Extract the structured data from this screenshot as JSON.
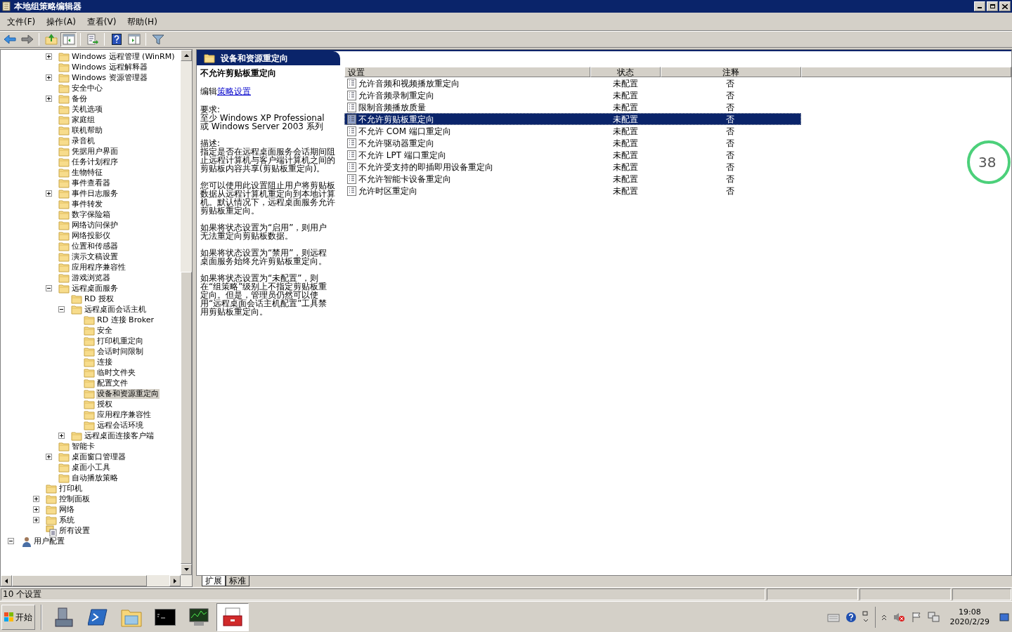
{
  "window": {
    "title": "本地组策略编辑器"
  },
  "menu": [
    "文件(F)",
    "操作(A)",
    "查看(V)",
    "帮助(H)"
  ],
  "toolbar": [
    {
      "kind": "back",
      "pressed": false
    },
    {
      "kind": "forward",
      "pressed": false
    },
    {
      "kind": "sep"
    },
    {
      "kind": "up",
      "pressed": false
    },
    {
      "kind": "tree",
      "pressed": true
    },
    {
      "kind": "sep"
    },
    {
      "kind": "export",
      "pressed": false
    },
    {
      "kind": "sep"
    },
    {
      "kind": "help",
      "pressed": false
    },
    {
      "kind": "pane",
      "pressed": false
    },
    {
      "kind": "sep"
    },
    {
      "kind": "filter",
      "pressed": false
    }
  ],
  "tree": [
    {
      "children": [
        {
          "children": [
            {
              "children": [
                {
                  "label": "Windows 远程管理 (WinRM)",
                  "kind": "folder",
                  "expanded": false,
                  "selected": false
                },
                {
                  "label": "Windows 远程解释器",
                  "kind": "folder",
                  "selected": false
                },
                {
                  "label": "Windows 资源管理器",
                  "kind": "folder",
                  "expanded": false,
                  "selected": false
                },
                {
                  "label": "安全中心",
                  "kind": "folder",
                  "selected": false
                },
                {
                  "label": "备份",
                  "kind": "folder",
                  "expanded": false,
                  "selected": false
                },
                {
                  "label": "关机选项",
                  "kind": "folder",
                  "selected": false
                },
                {
                  "label": "家庭组",
                  "kind": "folder",
                  "selected": false
                },
                {
                  "label": "联机帮助",
                  "kind": "folder",
                  "selected": false
                },
                {
                  "label": "录音机",
                  "kind": "folder",
                  "selected": false
                },
                {
                  "label": "凭据用户界面",
                  "kind": "folder",
                  "selected": false
                },
                {
                  "label": "任务计划程序",
                  "kind": "folder",
                  "selected": false
                },
                {
                  "label": "生物特征",
                  "kind": "folder",
                  "selected": false
                },
                {
                  "label": "事件查看器",
                  "kind": "folder",
                  "selected": false
                },
                {
                  "label": "事件日志服务",
                  "kind": "folder",
                  "expanded": false,
                  "selected": false
                },
                {
                  "label": "事件转发",
                  "kind": "folder",
                  "selected": false
                },
                {
                  "label": "数字保险箱",
                  "kind": "folder",
                  "selected": false
                },
                {
                  "label": "网络访问保护",
                  "kind": "folder",
                  "selected": false
                },
                {
                  "label": "网络投影仪",
                  "kind": "folder",
                  "selected": false
                },
                {
                  "label": "位置和传感器",
                  "kind": "folder",
                  "selected": false
                },
                {
                  "label": "演示文稿设置",
                  "kind": "folder",
                  "selected": false
                },
                {
                  "label": "应用程序兼容性",
                  "kind": "folder",
                  "selected": false
                },
                {
                  "label": "游戏浏览器",
                  "kind": "folder",
                  "selected": false
                },
                {
                  "label": "远程桌面服务",
                  "kind": "folder",
                  "expanded": true,
                  "selected": false,
                  "children": [
                    {
                      "label": "RD 授权",
                      "kind": "folder",
                      "selected": false
                    },
                    {
                      "label": "远程桌面会话主机",
                      "kind": "folder",
                      "expanded": true,
                      "selected": false,
                      "children": [
                        {
                          "label": "RD 连接 Broker",
                          "kind": "folder",
                          "selected": false
                        },
                        {
                          "label": "安全",
                          "kind": "folder",
                          "selected": false
                        },
                        {
                          "label": "打印机重定向",
                          "kind": "folder",
                          "selected": false
                        },
                        {
                          "label": "会话时间限制",
                          "kind": "folder",
                          "selected": false
                        },
                        {
                          "label": "连接",
                          "kind": "folder",
                          "selected": false
                        },
                        {
                          "label": "临时文件夹",
                          "kind": "folder",
                          "selected": false
                        },
                        {
                          "label": "配置文件",
                          "kind": "folder",
                          "selected": false
                        },
                        {
                          "label": "设备和资源重定向",
                          "kind": "folder",
                          "selected": true
                        },
                        {
                          "label": "授权",
                          "kind": "folder",
                          "selected": false
                        },
                        {
                          "label": "应用程序兼容性",
                          "kind": "folder",
                          "selected": false
                        },
                        {
                          "label": "远程会话环境",
                          "kind": "folder",
                          "selected": false
                        }
                      ]
                    },
                    {
                      "label": "远程桌面连接客户端",
                      "kind": "folder",
                      "expanded": false,
                      "selected": false
                    }
                  ]
                },
                {
                  "label": "智能卡",
                  "kind": "folder",
                  "selected": false
                },
                {
                  "label": "桌面窗口管理器",
                  "kind": "folder",
                  "expanded": false,
                  "selected": false
                },
                {
                  "label": "桌面小工具",
                  "kind": "folder",
                  "selected": false
                },
                {
                  "label": "自动播放策略",
                  "kind": "folder",
                  "selected": false
                }
              ]
            },
            {
              "label": "打印机",
              "kind": "folder",
              "selected": false
            },
            {
              "label": "控制面板",
              "kind": "folder",
              "expanded": false,
              "selected": false
            },
            {
              "label": "网络",
              "kind": "folder",
              "expanded": false,
              "selected": false
            },
            {
              "label": "系统",
              "kind": "folder",
              "expanded": false,
              "selected": false
            },
            {
              "label": "所有设置",
              "kind": "settings",
              "selected": false
            }
          ]
        }
      ]
    },
    {
      "label": "用户配置",
      "kind": "user",
      "expanded": true,
      "selected": false
    }
  ],
  "details": {
    "header": "设备和资源重定向",
    "title": "不允许剪贴板重定向",
    "edit_prefix": "编辑",
    "edit_link": "策略设置",
    "paragraphs": [
      "要求:\n至少 Windows XP Professional 或 Windows Server 2003 系列",
      "描述:\n指定是否在远程桌面服务会话期间阻止远程计算机与客户端计算机之间的剪贴板内容共享(剪贴板重定向)。",
      "您可以使用此设置阻止用户将剪贴板数据从远程计算机重定向到本地计算机。默认情况下，远程桌面服务允许剪贴板重定向。",
      "如果将状态设置为“启用”，则用户无法重定向剪贴板数据。",
      "如果将状态设置为“禁用”，则远程桌面服务始终允许剪贴板重定向。",
      "如果将状态设置为“未配置”，则在“组策略”级别上不指定剪贴板重定向。但是，管理员仍然可以使用“远程桌面会话主机配置”工具禁用剪贴板重定向。"
    ]
  },
  "table": {
    "columns": [
      "设置",
      "状态",
      "注释"
    ],
    "rows": [
      {
        "name": "允许音频和视频播放重定向",
        "state": "未配置",
        "comment": "否",
        "selected": false
      },
      {
        "name": "允许音频录制重定向",
        "state": "未配置",
        "comment": "否",
        "selected": false
      },
      {
        "name": "限制音频播放质量",
        "state": "未配置",
        "comment": "否",
        "selected": false
      },
      {
        "name": "不允许剪贴板重定向",
        "state": "未配置",
        "comment": "否",
        "selected": true
      },
      {
        "name": "不允许 COM 端口重定向",
        "state": "未配置",
        "comment": "否",
        "selected": false
      },
      {
        "name": "不允许驱动器重定向",
        "state": "未配置",
        "comment": "否",
        "selected": false
      },
      {
        "name": "不允许 LPT 端口重定向",
        "state": "未配置",
        "comment": "否",
        "selected": false
      },
      {
        "name": "不允许受支持的即插即用设备重定向",
        "state": "未配置",
        "comment": "否",
        "selected": false
      },
      {
        "name": "不允许智能卡设备重定向",
        "state": "未配置",
        "comment": "否",
        "selected": false
      },
      {
        "name": "允许时区重定向",
        "state": "未配置",
        "comment": "否",
        "selected": false
      }
    ]
  },
  "view_tabs": [
    {
      "label": "扩展",
      "selected": true
    },
    {
      "label": "标准",
      "selected": false
    }
  ],
  "status_bar": {
    "text": "10 个设置"
  },
  "overlay_gauge": {
    "value": "38"
  },
  "taskbar": {
    "start": "开始",
    "buttons": [
      {
        "kind": "server",
        "selected": false
      },
      {
        "kind": "shell",
        "selected": false
      },
      {
        "kind": "explorer",
        "selected": false
      },
      {
        "kind": "cmd",
        "selected": false
      },
      {
        "kind": "monitor",
        "selected": false
      },
      {
        "kind": "toolbox",
        "selected": true
      }
    ],
    "time": "19:08",
    "date": "2020/2/29"
  }
}
